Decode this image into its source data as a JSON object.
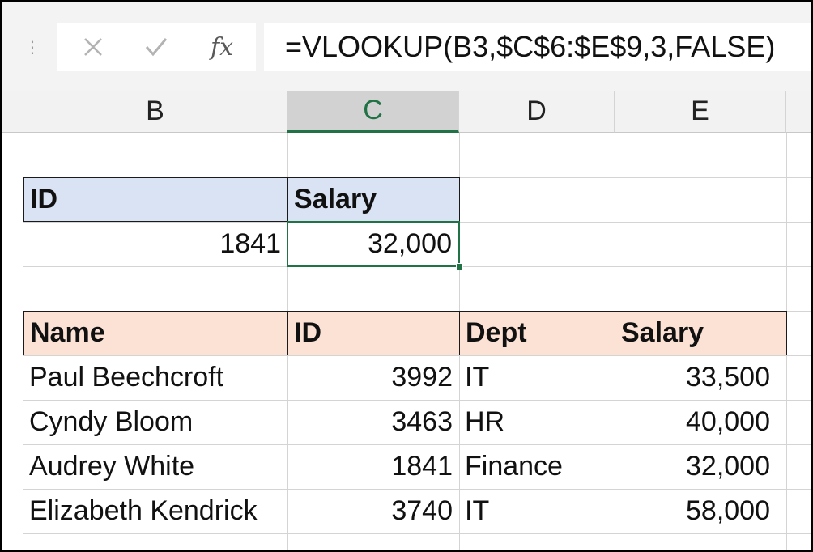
{
  "formula_bar": {
    "cancel_icon": "×",
    "enter_icon": "✓",
    "fx_label": "fx",
    "formula": "=VLOOKUP(B3,$C$6:$E$9,3,FALSE)"
  },
  "columns": [
    "B",
    "C",
    "D",
    "E"
  ],
  "selected_column": "C",
  "lookup": {
    "headers": [
      "ID",
      "Salary"
    ],
    "id_value": "1841",
    "salary_value": "32,000"
  },
  "table": {
    "headers": [
      "Name",
      "ID",
      "Dept",
      "Salary"
    ],
    "rows": [
      [
        "Paul Beechcroft",
        "3992",
        "IT",
        "33,500"
      ],
      [
        "Cyndy Bloom",
        "3463",
        "HR",
        "40,000"
      ],
      [
        "Audrey White",
        "1841",
        "Finance",
        "32,000"
      ],
      [
        "Elizabeth Kendrick",
        "3740",
        "IT",
        "58,000"
      ]
    ]
  },
  "colors": {
    "accent": "#217346",
    "lookup_header": "#dae3f3",
    "table_header": "#fbe2d5"
  }
}
